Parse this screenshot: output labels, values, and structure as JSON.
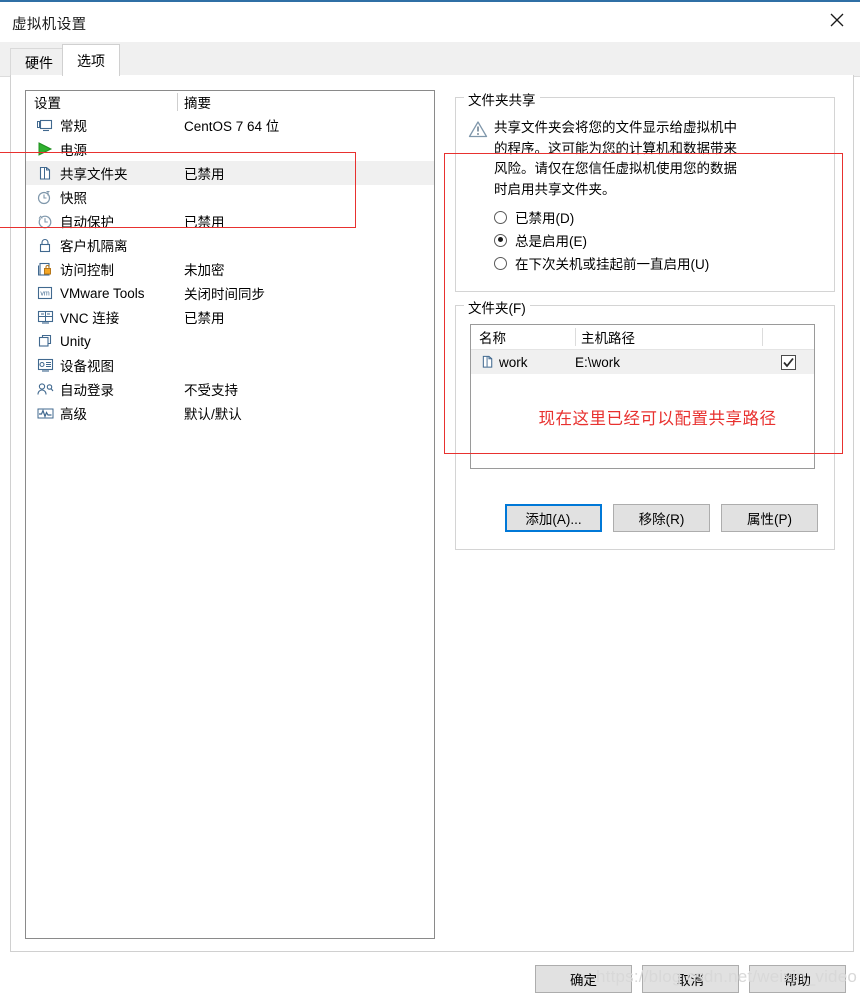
{
  "window": {
    "title": "虚拟机设置",
    "close_icon": "close-icon"
  },
  "tabs": [
    {
      "label": "硬件",
      "active": false
    },
    {
      "label": "选项",
      "active": true
    }
  ],
  "settings_list": {
    "headers": {
      "setting": "设置",
      "summary": "摘要"
    },
    "rows": [
      {
        "icon": "monitor-icon",
        "label": "常规",
        "summary": "CentOS 7 64 位",
        "selected": false
      },
      {
        "icon": "power-play-icon",
        "label": "电源",
        "summary": "",
        "selected": false
      },
      {
        "icon": "shared-folder-icon",
        "label": "共享文件夹",
        "summary": "已禁用",
        "selected": true
      },
      {
        "icon": "snapshot-clock-icon",
        "label": "快照",
        "summary": "",
        "selected": false
      },
      {
        "icon": "autoprotect-icon",
        "label": "自动保护",
        "summary": "已禁用",
        "selected": false
      },
      {
        "icon": "lock-icon",
        "label": "客户机隔离",
        "summary": "",
        "selected": false
      },
      {
        "icon": "access-control-icon",
        "label": "访问控制",
        "summary": "未加密",
        "selected": false
      },
      {
        "icon": "vmware-tools-icon",
        "label": "VMware Tools",
        "summary": "关闭时间同步",
        "selected": false
      },
      {
        "icon": "vnc-icon",
        "label": "VNC 连接",
        "summary": "已禁用",
        "selected": false
      },
      {
        "icon": "unity-icon",
        "label": "Unity",
        "summary": "",
        "selected": false
      },
      {
        "icon": "device-view-icon",
        "label": "设备视图",
        "summary": "",
        "selected": false
      },
      {
        "icon": "auto-login-icon",
        "label": "自动登录",
        "summary": "不受支持",
        "selected": false
      },
      {
        "icon": "advanced-icon",
        "label": "高级",
        "summary": "默认/默认",
        "selected": false
      }
    ]
  },
  "sharing_group": {
    "legend": "文件夹共享",
    "warning_icon": "warning-triangle-icon",
    "warning_text": "共享文件夹会将您的文件显示给虚拟机中\n的程序。这可能为您的计算机和数据带来\n风险。请仅在您信任虚拟机使用您的数据\n时启用共享文件夹。",
    "options": [
      {
        "label": "已禁用(D)",
        "checked": false
      },
      {
        "label": "总是启用(E)",
        "checked": true
      },
      {
        "label": "在下次关机或挂起前一直启用(U)",
        "checked": false
      }
    ]
  },
  "folders_group": {
    "legend": "文件夹(F)",
    "headers": {
      "name": "名称",
      "host_path": "主机路径",
      "enabled": ""
    },
    "rows": [
      {
        "icon": "shared-folder-icon",
        "name": "work",
        "host_path": "E:\\work",
        "enabled": true
      }
    ],
    "annotation": "现在这里已经可以配置共享路径",
    "buttons": [
      {
        "label": "添加(A)...",
        "focused": true
      },
      {
        "label": "移除(R)",
        "focused": false
      },
      {
        "label": "属性(P)",
        "focused": false
      }
    ]
  },
  "dialog_buttons": [
    {
      "label": "确定"
    },
    {
      "label": "取消"
    },
    {
      "label": "帮助"
    }
  ],
  "watermark": {
    "text": "https://blog.csdn.net/weixin_video"
  },
  "colors": {
    "accent": "#0078d7",
    "annotation_red": "#e8312f",
    "titlebar_accent": "#2f6fa5",
    "selection": "#f0f0f0"
  }
}
